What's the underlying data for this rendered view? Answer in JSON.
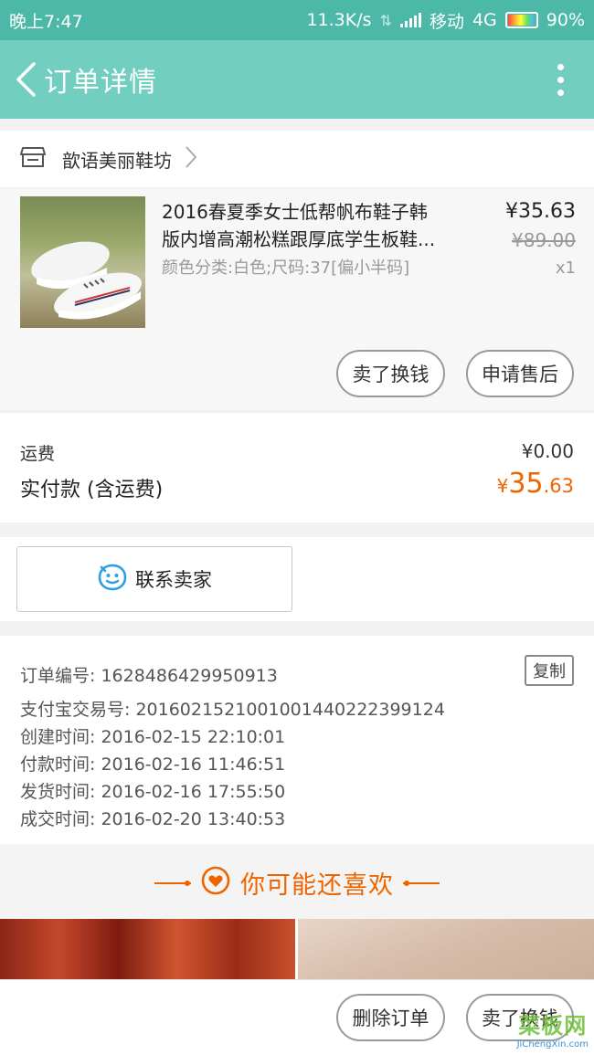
{
  "status_bar": {
    "time": "晚上7:47",
    "speed": "11.3K/s",
    "carrier": "移动",
    "network": "4G",
    "battery": "90%"
  },
  "nav": {
    "title": "订单详情"
  },
  "shop": {
    "name": "歆语美丽鞋坊"
  },
  "product": {
    "title_line1": "2016春夏季女士低帮帆布鞋子韩",
    "title_line2": "版内增高潮松糕跟厚底学生板鞋...",
    "sku": "颜色分类:白色;尺码:37[偏小半码]",
    "price": "¥35.63",
    "original_price": "¥89.00",
    "quantity": "x1",
    "sell_button": "卖了换钱",
    "after_sale_button": "申请售后"
  },
  "fees": {
    "shipping_label": "运费",
    "shipping_value": "¥0.00",
    "total_label": "实付款 (含运费)",
    "total_symbol": "¥",
    "total_int": "35",
    "total_dec": ".63"
  },
  "contact": {
    "label": "联系卖家"
  },
  "order_info": {
    "order_no": "订单编号: 1628486429950913",
    "copy_label": "复制",
    "alipay_no": "支付宝交易号: 2016021521001001440222399124",
    "created": "创建时间: 2016-02-15 22:10:01",
    "paid": "付款时间: 2016-02-16 11:46:51",
    "shipped": "发货时间: 2016-02-16 17:55:50",
    "completed": "成交时间: 2016-02-20 13:40:53"
  },
  "recommend": {
    "title": "你可能还喜欢"
  },
  "bottom_bar": {
    "delete_button": "删除订单",
    "sell_button": "卖了换钱"
  },
  "watermark": {
    "top": "菜板网",
    "bottom": "JiChengXin.com"
  },
  "colors": {
    "status_bar": "#4cb9a8",
    "nav_bar": "#72cebf",
    "accent_orange": "#f06400",
    "contact_icon": "#2b9fe6"
  }
}
